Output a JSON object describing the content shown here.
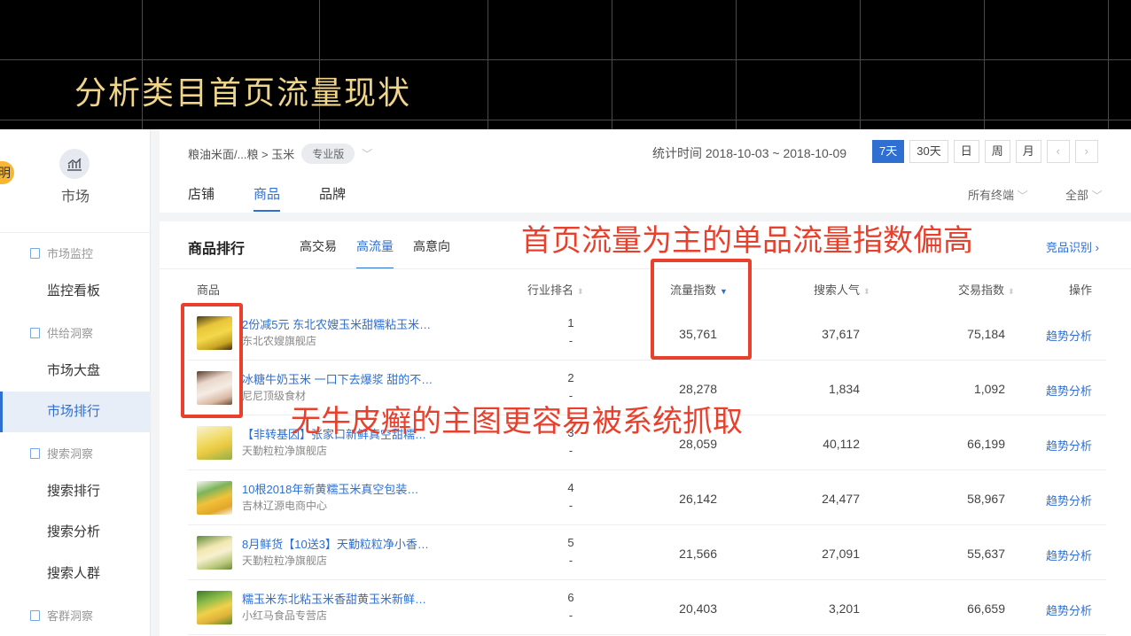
{
  "banner": {
    "title": "分析类目首页流量现状"
  },
  "sidebar": {
    "left_badge": "明",
    "market_label": "市场",
    "sections": [
      {
        "label": "市场监控"
      },
      {
        "label": "供给洞察"
      },
      {
        "label": "搜索洞察"
      },
      {
        "label": "客群洞察"
      }
    ],
    "items": [
      {
        "label": "监控看板"
      },
      {
        "label": "市场大盘"
      },
      {
        "label": "市场排行"
      },
      {
        "label": "搜索排行"
      },
      {
        "label": "搜索分析"
      },
      {
        "label": "搜索人群"
      }
    ]
  },
  "header": {
    "breadcrumb": "粮油米面/...粮 > 玉米",
    "edition": "专业版",
    "stat_time": "统计时间 2018-10-03 ~ 2018-10-09",
    "ranges": [
      "7天",
      "30天",
      "日",
      "周",
      "月"
    ],
    "tabs": [
      "店铺",
      "商品",
      "品牌"
    ],
    "filter_terminal": "所有终端",
    "filter_all": "全部"
  },
  "ranking": {
    "title": "商品排行",
    "subtabs": [
      "高交易",
      "高流量",
      "高意向"
    ],
    "identify": "竞品识别",
    "columns": {
      "product": "商品",
      "industry_rank": "行业排名",
      "traffic_index": "流量指数",
      "search_popularity": "搜索人气",
      "trade_index": "交易指数",
      "action": "操作"
    },
    "rows": [
      {
        "name": "2份减5元 东北农嫂玉米甜糯粘玉米…",
        "shop": "东北农嫂旗舰店",
        "rank": "1",
        "change": "-",
        "traffic": "35,761",
        "search": "37,617",
        "trade": "75,184",
        "action": "趋势分析"
      },
      {
        "name": "冰糖牛奶玉米 一口下去爆浆 甜的不…",
        "shop": "尼尼顶级食材",
        "rank": "2",
        "change": "-",
        "traffic": "28,278",
        "search": "1,834",
        "trade": "1,092",
        "action": "趋势分析"
      },
      {
        "name": "【非转基因】张家口新鲜真空甜糯…",
        "shop": "天勤粒粒净旗舰店",
        "rank": "3",
        "change": "-",
        "traffic": "28,059",
        "search": "40,112",
        "trade": "66,199",
        "action": "趋势分析"
      },
      {
        "name": "10根2018年新黄糯玉米真空包装…",
        "shop": "吉林辽源电商中心",
        "rank": "4",
        "change": "-",
        "traffic": "26,142",
        "search": "24,477",
        "trade": "58,967",
        "action": "趋势分析"
      },
      {
        "name": "8月鲜货【10送3】天勤粒粒净小香…",
        "shop": "天勤粒粒净旗舰店",
        "rank": "5",
        "change": "-",
        "traffic": "21,566",
        "search": "27,091",
        "trade": "55,637",
        "action": "趋势分析"
      },
      {
        "name": "糯玉米东北粘玉米香甜黄玉米新鲜…",
        "shop": "小红马食品专营店",
        "rank": "6",
        "change": "-",
        "traffic": "20,403",
        "search": "3,201",
        "trade": "66,659",
        "action": "趋势分析"
      }
    ]
  },
  "annotations": {
    "top": "首页流量为主的单品流量指数偏高",
    "middle": "无牛皮癣的主图更容易被系统抓取"
  },
  "colors": {
    "accent": "#2f6fd1",
    "annotation": "#e8402c",
    "banner_title": "#f0d48a"
  }
}
